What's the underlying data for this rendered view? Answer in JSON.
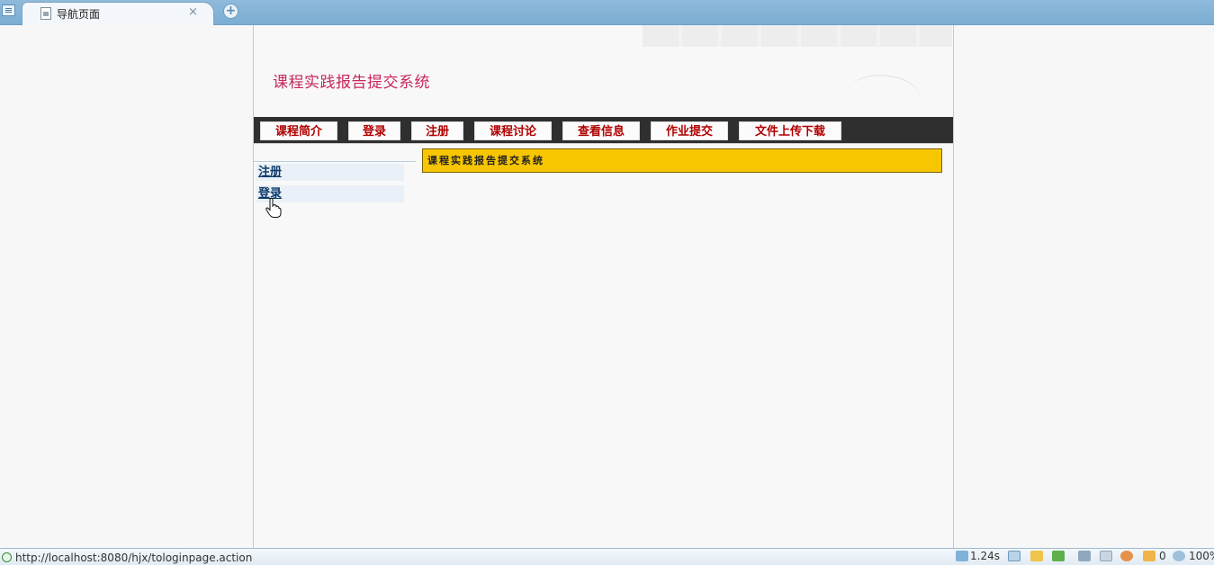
{
  "browser": {
    "tab_title": "导航页面",
    "tab_close": "×",
    "new_tab": "+"
  },
  "site": {
    "title": "课程实践报告提交系统"
  },
  "nav": {
    "items": [
      {
        "label": "课程简介"
      },
      {
        "label": "登录"
      },
      {
        "label": "注册"
      },
      {
        "label": "课程讨论"
      },
      {
        "label": "查看信息"
      },
      {
        "label": "作业提交"
      },
      {
        "label": "文件上传下载"
      }
    ]
  },
  "sidebar": {
    "items": [
      {
        "label": "注册"
      },
      {
        "label": "登录"
      }
    ]
  },
  "content": {
    "banner": "课程实践报告提交系统"
  },
  "status": {
    "url": "http://localhost:8080/hjx/tologinpage.action",
    "load_time": "1.24s",
    "count": "0",
    "zoom": "100%"
  },
  "colors": {
    "title": "#c8285a",
    "nav_text": "#b00000",
    "nav_bar": "#2f2f2f",
    "banner": "#f7c600"
  }
}
